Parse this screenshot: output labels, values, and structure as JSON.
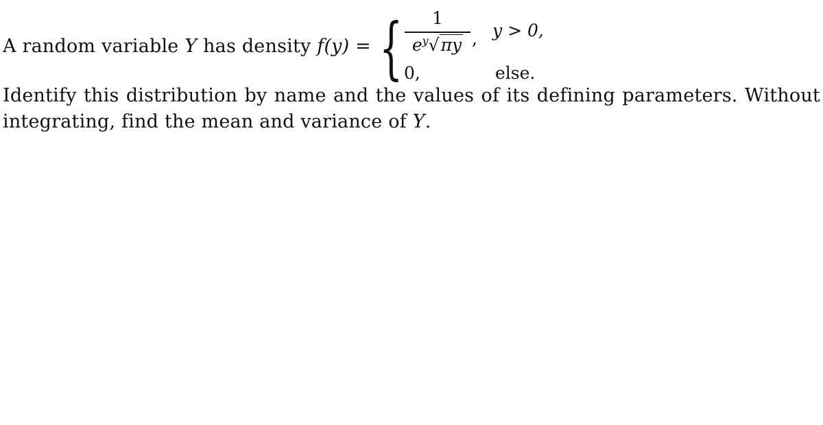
{
  "problem": {
    "line1_prefix": "A random variable ",
    "line1_var": "Y",
    "line1_mid": " has density ",
    "line1_func": "f(y) =",
    "piecewise": {
      "case1_numerator": "1",
      "case1_den_base": "e",
      "case1_den_exp": "y",
      "case1_den_sqrt_symbol": "√",
      "case1_den_radicand": "πy",
      "case1_comma": ",",
      "case1_condition": "y > 0,",
      "case2_value": "0,",
      "case2_condition": "else."
    },
    "line2_words": [
      "Identify",
      "this",
      "distribution",
      "by",
      "name",
      "and",
      "the",
      "values",
      "of",
      "its",
      "defining",
      "parameters.",
      "Without"
    ],
    "line3_prefix": "integrating, find the mean and variance of ",
    "line3_var": "Y",
    "line3_suffix": "."
  }
}
